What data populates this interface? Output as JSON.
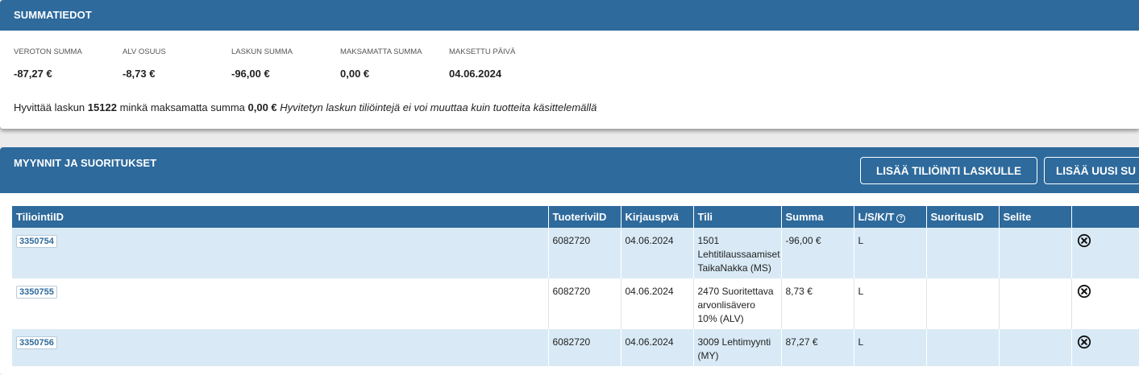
{
  "summary": {
    "title": "SUMMATIEDOT",
    "stats": [
      {
        "label": "VEROTON SUMMA",
        "value": "-87,27 €"
      },
      {
        "label": "ALV OSUUS",
        "value": "-8,73 €"
      },
      {
        "label": "LASKUN SUMMA",
        "value": "-96,00 €"
      },
      {
        "label": "MAKSAMATTA SUMMA",
        "value": "0,00 €"
      },
      {
        "label": "MAKSETTU PÄIVÄ",
        "value": "04.06.2024"
      }
    ],
    "note": {
      "prefix": "Hyvittää laskun",
      "invoice_number": "15122",
      "middle": "minkä maksamatta summa",
      "unpaid": "0,00 €",
      "italic": "Hyvitetyn laskun tiliöintejä ei voi muuttaa kuin tuotteita käsittelemällä"
    }
  },
  "sales": {
    "title": "MYYNNIT JA SUORITUKSET",
    "buttons": {
      "add_entry": "LISÄÄ TILIÖINTI LASKULLE",
      "add_new": "LISÄÄ UUSI SU"
    },
    "columns": [
      "TiliointiID",
      "TuoterivilD",
      "Kirjauspvä",
      "Tili",
      "Summa",
      "L/S/K/T",
      "SuoritusID",
      "Selite",
      ""
    ],
    "help_icon": "?",
    "rows": [
      {
        "id": "3350754",
        "product_row": "6082720",
        "date": "04.06.2024",
        "account": "1501 Lehtitilaussaamiset TaikaNakka (MS)",
        "amount": "-96,00 €",
        "lskt": "L",
        "payment_id": "",
        "description": ""
      },
      {
        "id": "3350755",
        "product_row": "6082720",
        "date": "04.06.2024",
        "account": "2470 Suoritettava arvonlisävero 10% (ALV)",
        "amount": "8,73 €",
        "lskt": "L",
        "payment_id": "",
        "description": ""
      },
      {
        "id": "3350756",
        "product_row": "6082720",
        "date": "04.06.2024",
        "account": "3009 Lehtimyynti (MY)",
        "amount": "87,27 €",
        "lskt": "L",
        "payment_id": "",
        "description": ""
      }
    ]
  },
  "icons": {
    "delete": "close-circle-icon",
    "help": "help-circle-icon"
  },
  "colors": {
    "header": "#2e6a9c",
    "row_alt": "#d9eaf6",
    "background": "#ebebeb"
  }
}
